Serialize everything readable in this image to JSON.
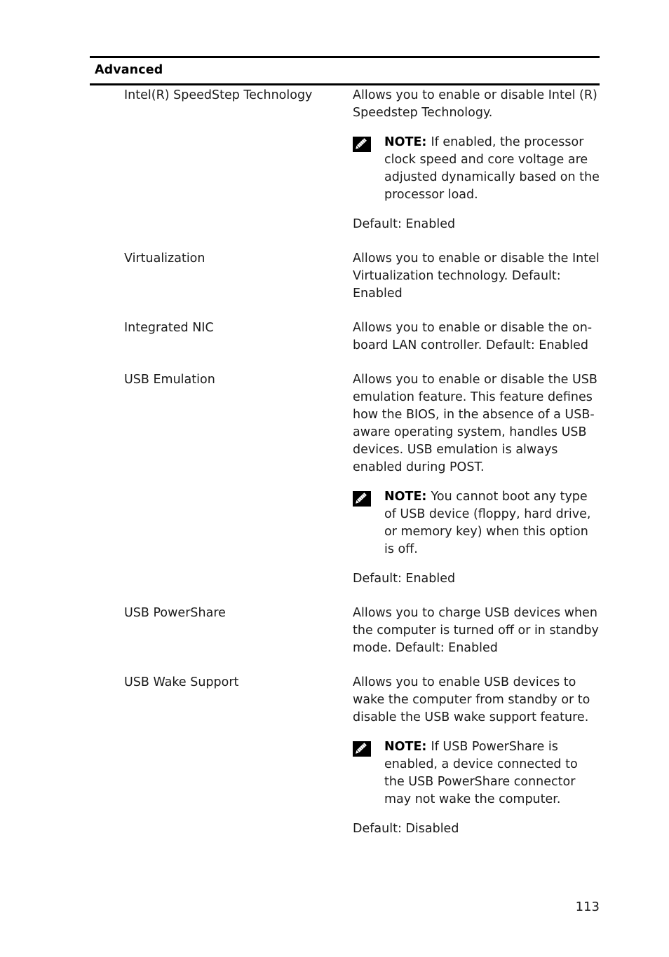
{
  "document": {
    "section_title": "Advanced",
    "page_number": "113",
    "note_icon_name": "dell-note-pencil-icon",
    "note_label": "NOTE:",
    "colors": {
      "text": "#1a1a1a",
      "rule": "#000000",
      "icon_background": "#000000",
      "icon_foreground": "#ffffff"
    }
  },
  "rows": [
    {
      "name": "Intel(R) SpeedStep Technology",
      "description": "Allows you to enable or disable Intel (R) Speedstep Technology.",
      "note": "If enabled, the processor clock speed and core voltage are adjusted dynamically based on the processor load.",
      "default": "Default: Enabled"
    },
    {
      "name": "Virtualization",
      "description": "Allows you to enable or disable the Intel Virtualization technology. Default: Enabled",
      "note": null,
      "default": null
    },
    {
      "name": "Integrated NIC",
      "description": "Allows you to enable or disable the on-board LAN controller. Default: Enabled",
      "note": null,
      "default": null
    },
    {
      "name": "USB Emulation",
      "description": "Allows you to enable or disable the USB emulation feature. This feature defines how the BIOS, in the absence of a USB-aware operating system, handles USB devices. USB emulation is always enabled during POST.",
      "note": "You cannot boot any type of USB device (floppy, hard drive, or memory key) when this option is off.",
      "default": "Default: Enabled"
    },
    {
      "name": "USB PowerShare",
      "description": "Allows you to charge USB devices when the computer is turned off or in standby mode. Default: Enabled",
      "note": null,
      "default": null
    },
    {
      "name": "USB Wake Support",
      "description": "Allows you to enable USB devices to wake the computer from standby or to disable the USB wake support feature.",
      "note": "If USB PowerShare is enabled, a device connected to the USB PowerShare connector may not wake the computer.",
      "default": "Default: Disabled"
    }
  ]
}
